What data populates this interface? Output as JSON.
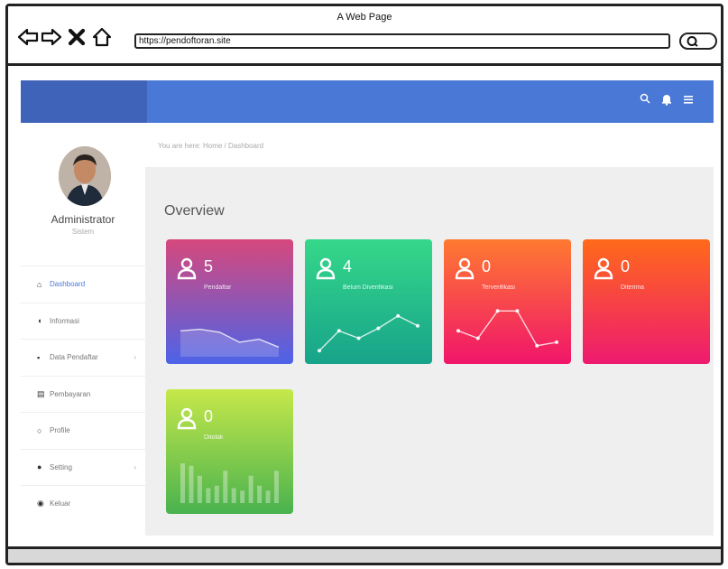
{
  "browser": {
    "window_title": "A Web Page",
    "url": "https://pendoftoran.site"
  },
  "topbar": {
    "icons": [
      "search-icon",
      "bell-icon",
      "menu-icon"
    ]
  },
  "user": {
    "name": "Administrator",
    "role": "Sistem"
  },
  "breadcrumb": "You are here: Home / Dashboard",
  "menu": [
    {
      "label": "Dashboard",
      "icon": "home-icon",
      "active": true,
      "submenu": false
    },
    {
      "label": "Informasi",
      "icon": "megaphone-icon",
      "active": false,
      "submenu": false
    },
    {
      "label": "Data Pendaftar",
      "icon": "chart-icon",
      "active": false,
      "submenu": true
    },
    {
      "label": "Pembayaran",
      "icon": "card-icon",
      "active": false,
      "submenu": false
    },
    {
      "label": "Profile",
      "icon": "user-icon",
      "active": false,
      "submenu": false
    },
    {
      "label": "Setting",
      "icon": "lock-icon",
      "active": false,
      "submenu": true
    },
    {
      "label": "Keluar",
      "icon": "power-icon",
      "active": false,
      "submenu": false
    }
  ],
  "overview": {
    "title": "Overview",
    "cards": [
      {
        "value": "5",
        "label": "Pendaftar",
        "gradient": [
          "#d6487c",
          "#4d63e8"
        ],
        "spark": "area",
        "points": [
          0.45,
          0.48,
          0.42,
          0.22,
          0.28,
          0.12
        ]
      },
      {
        "value": "4",
        "label": "Belum Diverifikasi",
        "gradient": [
          "#35d88a",
          "#17a38a"
        ],
        "spark": "line",
        "points": [
          0.05,
          0.45,
          0.3,
          0.5,
          0.75,
          0.55
        ]
      },
      {
        "value": "0",
        "label": "Terverifikasi",
        "gradient": [
          "#ff7a30",
          "#f0156a"
        ],
        "spark": "line",
        "points": [
          0.45,
          0.3,
          0.85,
          0.85,
          0.15,
          0.22
        ]
      },
      {
        "value": "0",
        "label": "Diterima",
        "gradient": [
          "#ff6a1a",
          "#ee1a70"
        ],
        "spark": "none",
        "points": []
      },
      {
        "value": "0",
        "label": "Ditolak",
        "gradient": [
          "#c6e84a",
          "#49b24e"
        ],
        "spark": "bar",
        "points": [
          0.8,
          0.75,
          0.55,
          0.3,
          0.35,
          0.65,
          0.3,
          0.25,
          0.55,
          0.35,
          0.25,
          0.65
        ]
      }
    ]
  }
}
